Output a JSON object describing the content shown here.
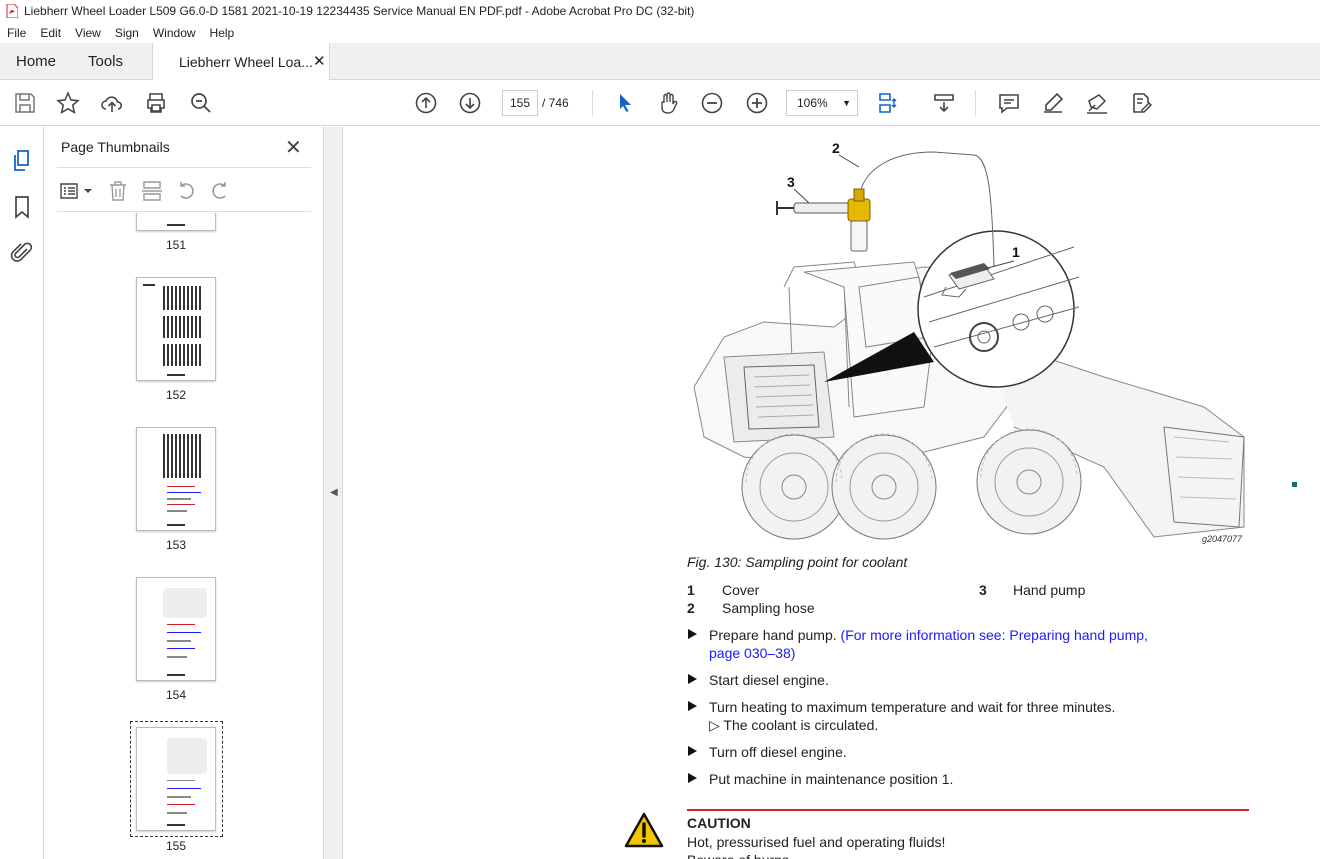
{
  "window": {
    "title": "Liebherr Wheel Loader L509 G6.0-D 1581 2021-10-19 12234435 Service Manual EN PDF.pdf - Adobe Acrobat Pro DC (32-bit)"
  },
  "menu": [
    "File",
    "Edit",
    "View",
    "Sign",
    "Window",
    "Help"
  ],
  "tabs": {
    "home": "Home",
    "tools": "Tools",
    "doc": "Liebherr Wheel Loa...",
    "close": "✕"
  },
  "toolbar": {
    "page_current": "155",
    "page_total": "/ 746",
    "zoom": "106%"
  },
  "panel": {
    "title": "Page Thumbnails",
    "close": "✕",
    "thumbs": [
      {
        "label": "151"
      },
      {
        "label": "152"
      },
      {
        "label": "153"
      },
      {
        "label": "154"
      },
      {
        "label": "155"
      }
    ]
  },
  "figure": {
    "callouts": [
      "1",
      "2",
      "3"
    ],
    "code": "g2047077",
    "caption": "Fig. 130: Sampling point for coolant"
  },
  "legend": [
    {
      "num": "1",
      "text": "Cover"
    },
    {
      "num": "2",
      "text": "Sampling hose"
    },
    {
      "num": "3",
      "text": "Hand pump"
    }
  ],
  "steps": {
    "s1": "Prepare hand pump.",
    "s1_link_a": "(For more information see: Preparing hand pump,",
    "s1_link_b": "page 030–38)",
    "s2": "Start diesel engine.",
    "s3": "Turn heating to maximum temperature and wait for three minutes.",
    "s3_result": "▷  The coolant is circulated.",
    "s4": "Turn off diesel engine.",
    "s5": "Put machine in maintenance position 1."
  },
  "caution": {
    "title": "CAUTION",
    "text": "Hot, pressurised fuel and operating fluids!",
    "next": "Beware of burns"
  },
  "colors": {
    "accent": "#d8202a",
    "link": "#1a1aff",
    "hose_yellow": "#e8b800"
  }
}
